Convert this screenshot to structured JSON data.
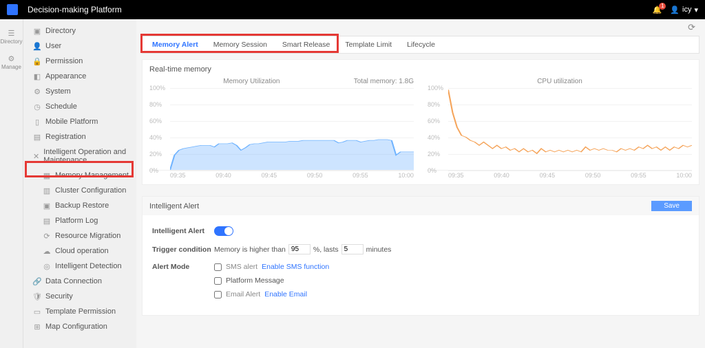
{
  "app": {
    "title": "Decision-making Platform",
    "user": "icy",
    "notifications": 1
  },
  "rail": {
    "directory": "Directory",
    "manage": "Manage"
  },
  "menu": {
    "directory": "Directory",
    "user": "User",
    "permission": "Permission",
    "appearance": "Appearance",
    "system": "System",
    "schedule": "Schedule",
    "mobile": "Mobile Platform",
    "registration": "Registration",
    "iom": "Intelligent Operation and Maintenance",
    "memory": "Memory Management",
    "cluster": "Cluster Configuration",
    "backup": "Backup Restore",
    "plog": "Platform Log",
    "resmig": "Resource Migration",
    "cloudop": "Cloud operation",
    "intdet": "Intelligent Detection",
    "dataconn": "Data Connection",
    "security": "Security",
    "tplperm": "Template Permission",
    "mapcfg": "Map Configuration"
  },
  "tabs": {
    "memory_alert": "Memory Alert",
    "memory_session": "Memory Session",
    "smart_release": "Smart Release",
    "template_limit": "Template Limit",
    "lifecycle": "Lifecycle"
  },
  "realtime": {
    "title": "Real-time memory",
    "mem_title": "Memory Utilization",
    "cpu_title": "CPU utilization",
    "total_mem": "Total memory: 1.8G"
  },
  "alert": {
    "section": "Intelligent Alert",
    "save": "Save",
    "label_alert": "Intelligent Alert",
    "label_trigger": "Trigger condition",
    "trigger_prefix": "Memory is higher than",
    "trigger_mid": "%, lasts",
    "trigger_suffix": "minutes",
    "threshold": "95",
    "duration": "5",
    "label_mode": "Alert Mode",
    "sms": "SMS alert",
    "sms_link": "Enable SMS function",
    "platform_msg": "Platform Message",
    "email": "Email Alert",
    "email_link": "Enable Email"
  },
  "chart_data": [
    {
      "type": "area",
      "title": "Memory Utilization",
      "ylabel": "",
      "ylim": [
        0,
        100
      ],
      "yticks": [
        0,
        20,
        40,
        60,
        80,
        100
      ],
      "x": [
        "09:35",
        "09:40",
        "09:45",
        "09:50",
        "09:55",
        "10:00"
      ],
      "series": [
        {
          "name": "memory",
          "color": "#6fb3ff",
          "values_dense": [
            0,
            18,
            24,
            26,
            27,
            28,
            29,
            30,
            30,
            30,
            28,
            32,
            32,
            32,
            33,
            30,
            24,
            27,
            31,
            32,
            32,
            33,
            34,
            34,
            34,
            34,
            34,
            35,
            35,
            35,
            36,
            36,
            36,
            36,
            36,
            36,
            36,
            36,
            33,
            34,
            36,
            36,
            36,
            34,
            35,
            36,
            36,
            37,
            37,
            37,
            36,
            18,
            22,
            22,
            22,
            22
          ]
        }
      ],
      "annotation": "Total memory: 1.8G"
    },
    {
      "type": "line",
      "title": "CPU utilization",
      "ylabel": "",
      "ylim": [
        0,
        100
      ],
      "yticks": [
        0,
        20,
        40,
        60,
        80,
        100
      ],
      "x": [
        "09:35",
        "09:40",
        "09:45",
        "09:50",
        "09:55",
        "10:00"
      ],
      "series": [
        {
          "name": "cpu",
          "color": "#f5a45a",
          "values_dense": [
            98,
            70,
            52,
            42,
            40,
            36,
            34,
            30,
            34,
            30,
            26,
            30,
            26,
            28,
            24,
            26,
            22,
            26,
            22,
            24,
            20,
            26,
            22,
            24,
            22,
            24,
            22,
            24,
            22,
            24,
            22,
            28,
            24,
            26,
            24,
            26,
            24,
            24,
            22,
            26,
            24,
            26,
            24,
            28,
            26,
            30,
            26,
            28,
            24,
            28,
            24,
            28,
            26,
            30,
            28,
            30
          ]
        }
      ]
    }
  ]
}
